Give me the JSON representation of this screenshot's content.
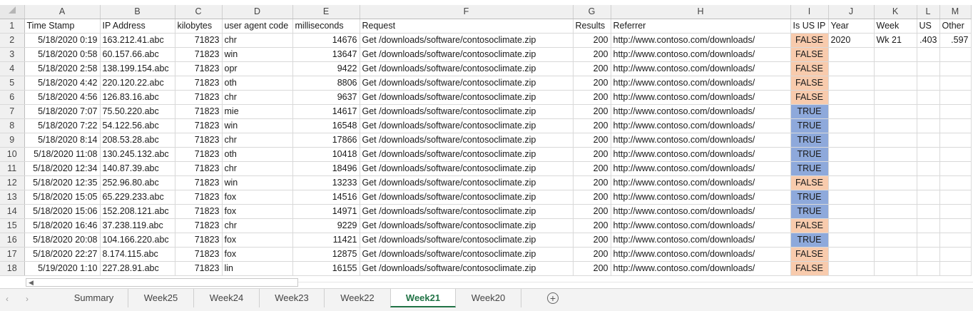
{
  "columns": [
    "A",
    "B",
    "C",
    "D",
    "E",
    "F",
    "G",
    "H",
    "I",
    "J",
    "K",
    "L",
    "M"
  ],
  "headers": [
    "Time Stamp",
    "IP Address",
    "kilobytes",
    "user agent code",
    "milliseconds",
    "Request",
    "Results",
    "Referrer",
    "Is US IP",
    "Year",
    "Week",
    "US",
    "Other"
  ],
  "rows": [
    {
      "n": "2",
      "ts": "5/18/2020 0:19",
      "ip": "163.212.41.abc",
      "kb": "71823",
      "ua": "chr",
      "ms": "14676",
      "req": "Get /downloads/software/contosoclimate.zip",
      "res": "200",
      "ref": "http://www.contoso.com/downloads/",
      "us": "FALSE",
      "year": "2020",
      "week": "Wk 21",
      "usv": ".403",
      "other": ".597"
    },
    {
      "n": "3",
      "ts": "5/18/2020 0:58",
      "ip": "60.157.66.abc",
      "kb": "71823",
      "ua": "win",
      "ms": "13647",
      "req": "Get /downloads/software/contosoclimate.zip",
      "res": "200",
      "ref": "http://www.contoso.com/downloads/",
      "us": "FALSE",
      "year": "",
      "week": "",
      "usv": "",
      "other": ""
    },
    {
      "n": "4",
      "ts": "5/18/2020 2:58",
      "ip": "138.199.154.abc",
      "kb": "71823",
      "ua": "opr",
      "ms": "9422",
      "req": "Get /downloads/software/contosoclimate.zip",
      "res": "200",
      "ref": "http://www.contoso.com/downloads/",
      "us": "FALSE",
      "year": "",
      "week": "",
      "usv": "",
      "other": ""
    },
    {
      "n": "5",
      "ts": "5/18/2020 4:42",
      "ip": "220.120.22.abc",
      "kb": "71823",
      "ua": "oth",
      "ms": "8806",
      "req": "Get /downloads/software/contosoclimate.zip",
      "res": "200",
      "ref": "http://www.contoso.com/downloads/",
      "us": "FALSE",
      "year": "",
      "week": "",
      "usv": "",
      "other": ""
    },
    {
      "n": "6",
      "ts": "5/18/2020 4:56",
      "ip": "126.83.16.abc",
      "kb": "71823",
      "ua": "chr",
      "ms": "9637",
      "req": "Get /downloads/software/contosoclimate.zip",
      "res": "200",
      "ref": "http://www.contoso.com/downloads/",
      "us": "FALSE",
      "year": "",
      "week": "",
      "usv": "",
      "other": ""
    },
    {
      "n": "7",
      "ts": "5/18/2020 7:07",
      "ip": "75.50.220.abc",
      "kb": "71823",
      "ua": "mie",
      "ms": "14617",
      "req": "Get /downloads/software/contosoclimate.zip",
      "res": "200",
      "ref": "http://www.contoso.com/downloads/",
      "us": "TRUE",
      "year": "",
      "week": "",
      "usv": "",
      "other": ""
    },
    {
      "n": "8",
      "ts": "5/18/2020 7:22",
      "ip": "54.122.56.abc",
      "kb": "71823",
      "ua": "win",
      "ms": "16548",
      "req": "Get /downloads/software/contosoclimate.zip",
      "res": "200",
      "ref": "http://www.contoso.com/downloads/",
      "us": "TRUE",
      "year": "",
      "week": "",
      "usv": "",
      "other": ""
    },
    {
      "n": "9",
      "ts": "5/18/2020 8:14",
      "ip": "208.53.28.abc",
      "kb": "71823",
      "ua": "chr",
      "ms": "17866",
      "req": "Get /downloads/software/contosoclimate.zip",
      "res": "200",
      "ref": "http://www.contoso.com/downloads/",
      "us": "TRUE",
      "year": "",
      "week": "",
      "usv": "",
      "other": ""
    },
    {
      "n": "10",
      "ts": "5/18/2020 11:08",
      "ip": "130.245.132.abc",
      "kb": "71823",
      "ua": "oth",
      "ms": "10418",
      "req": "Get /downloads/software/contosoclimate.zip",
      "res": "200",
      "ref": "http://www.contoso.com/downloads/",
      "us": "TRUE",
      "year": "",
      "week": "",
      "usv": "",
      "other": ""
    },
    {
      "n": "11",
      "ts": "5/18/2020 12:34",
      "ip": "140.87.39.abc",
      "kb": "71823",
      "ua": "chr",
      "ms": "18496",
      "req": "Get /downloads/software/contosoclimate.zip",
      "res": "200",
      "ref": "http://www.contoso.com/downloads/",
      "us": "TRUE",
      "year": "",
      "week": "",
      "usv": "",
      "other": ""
    },
    {
      "n": "12",
      "ts": "5/18/2020 12:35",
      "ip": "252.96.80.abc",
      "kb": "71823",
      "ua": "win",
      "ms": "13233",
      "req": "Get /downloads/software/contosoclimate.zip",
      "res": "200",
      "ref": "http://www.contoso.com/downloads/",
      "us": "FALSE",
      "year": "",
      "week": "",
      "usv": "",
      "other": ""
    },
    {
      "n": "13",
      "ts": "5/18/2020 15:05",
      "ip": "65.229.233.abc",
      "kb": "71823",
      "ua": "fox",
      "ms": "14516",
      "req": "Get /downloads/software/contosoclimate.zip",
      "res": "200",
      "ref": "http://www.contoso.com/downloads/",
      "us": "TRUE",
      "year": "",
      "week": "",
      "usv": "",
      "other": ""
    },
    {
      "n": "14",
      "ts": "5/18/2020 15:06",
      "ip": "152.208.121.abc",
      "kb": "71823",
      "ua": "fox",
      "ms": "14971",
      "req": "Get /downloads/software/contosoclimate.zip",
      "res": "200",
      "ref": "http://www.contoso.com/downloads/",
      "us": "TRUE",
      "year": "",
      "week": "",
      "usv": "",
      "other": ""
    },
    {
      "n": "15",
      "ts": "5/18/2020 16:46",
      "ip": "37.238.119.abc",
      "kb": "71823",
      "ua": "chr",
      "ms": "9229",
      "req": "Get /downloads/software/contosoclimate.zip",
      "res": "200",
      "ref": "http://www.contoso.com/downloads/",
      "us": "FALSE",
      "year": "",
      "week": "",
      "usv": "",
      "other": ""
    },
    {
      "n": "16",
      "ts": "5/18/2020 20:08",
      "ip": "104.166.220.abc",
      "kb": "71823",
      "ua": "fox",
      "ms": "11421",
      "req": "Get /downloads/software/contosoclimate.zip",
      "res": "200",
      "ref": "http://www.contoso.com/downloads/",
      "us": "TRUE",
      "year": "",
      "week": "",
      "usv": "",
      "other": ""
    },
    {
      "n": "17",
      "ts": "5/18/2020 22:27",
      "ip": "8.174.115.abc",
      "kb": "71823",
      "ua": "fox",
      "ms": "12875",
      "req": "Get /downloads/software/contosoclimate.zip",
      "res": "200",
      "ref": "http://www.contoso.com/downloads/",
      "us": "FALSE",
      "year": "",
      "week": "",
      "usv": "",
      "other": ""
    },
    {
      "n": "18",
      "ts": "5/19/2020 1:10",
      "ip": "227.28.91.abc",
      "kb": "71823",
      "ua": "lin",
      "ms": "16155",
      "req": "Get /downloads/software/contosoclimate.zip",
      "res": "200",
      "ref": "http://www.contoso.com/downloads/",
      "us": "FALSE",
      "year": "",
      "week": "",
      "usv": "",
      "other": ""
    }
  ],
  "header_row_number": "1",
  "colors": {
    "false_fill": "#f8cbad",
    "true_fill": "#8ea9db",
    "active_tab": "#217346"
  },
  "tabs": [
    "Summary",
    "Week25",
    "Week24",
    "Week23",
    "Week22",
    "Week21",
    "Week20"
  ],
  "active_tab": "Week21",
  "icons": {
    "prev_sheet": "chevron-left-icon",
    "next_sheet": "chevron-right-icon",
    "add_sheet": "plus-circle-icon",
    "scroll_left": "scroll-left-arrow-icon"
  }
}
